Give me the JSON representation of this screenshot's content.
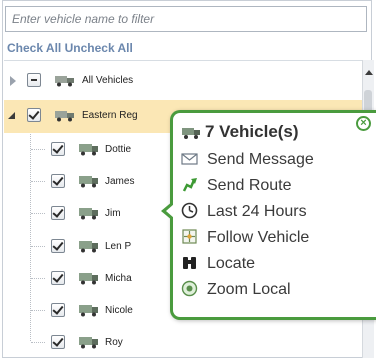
{
  "filter": {
    "placeholder": "Enter vehicle name to filter"
  },
  "check_all_label": "Check All",
  "uncheck_all_label": "Uncheck All",
  "tree": {
    "groups": [
      {
        "label": "All Vehicles",
        "expanded": false,
        "check_state": "partial"
      },
      {
        "label": "Eastern Reg",
        "expanded": true,
        "check_state": "checked",
        "selected": true
      }
    ],
    "vehicles": [
      {
        "label": "Dottie",
        "checked": true
      },
      {
        "label": "James",
        "checked": true
      },
      {
        "label": "Jim",
        "checked": true
      },
      {
        "label": "Len P",
        "checked": true
      },
      {
        "label": "Micha",
        "checked": true
      },
      {
        "label": "Nicole",
        "checked": true
      },
      {
        "label": "Roy",
        "checked": true
      }
    ]
  },
  "popup": {
    "title": "7 Vehicle(s)",
    "close_icon": "close-icon",
    "items": [
      {
        "label": "Send Message",
        "icon": "envelope-icon"
      },
      {
        "label": "Send Route",
        "icon": "route-arrow-icon"
      },
      {
        "label": "Last 24 Hours",
        "icon": "clock-icon"
      },
      {
        "label": "Follow Vehicle",
        "icon": "follow-target-icon"
      },
      {
        "label": "Locate",
        "icon": "binoculars-icon"
      },
      {
        "label": "Zoom Local",
        "icon": "zoom-circle-icon"
      }
    ]
  },
  "colors": {
    "popup_border": "#4a9b3e",
    "selected_row": "#fbe7b5",
    "link_text": "#6b87ad"
  }
}
